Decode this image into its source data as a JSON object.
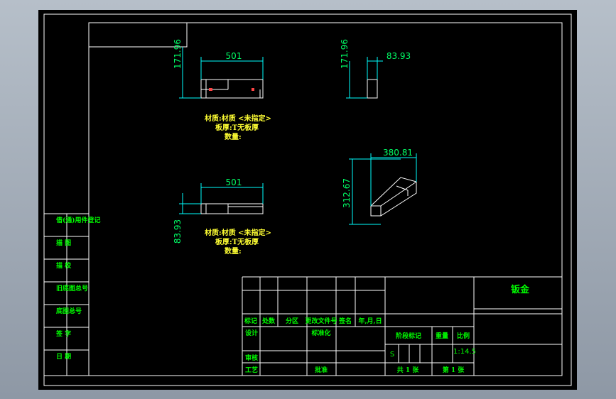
{
  "title_block": {
    "name": "钣金",
    "scale": "1:14.5",
    "stage_mark": "S",
    "headers": {
      "mark": "标记",
      "count": "处数",
      "zone": "分区",
      "doc_no": "更改文件号",
      "sign": "签名",
      "date": "年,月,日",
      "design": "设计",
      "standardize": "标准化",
      "review": "审核",
      "process": "工艺",
      "approve": "批准",
      "stage_label": "阶段标记",
      "weight": "重量",
      "scale_label": "比例",
      "sheets_total": "共 1 张",
      "sheet_no": "第 1 张"
    }
  },
  "side_panel": [
    "借(通)用件登记",
    "描 图",
    "描 校",
    "旧底图总号",
    "底图总号",
    "签 字",
    "日 期"
  ],
  "views": {
    "front": {
      "dim_width": "501",
      "dim_height": "171.96"
    },
    "side": {
      "dim_width": "83.93",
      "dim_height": "171.96"
    },
    "top": {
      "dim_width": "501",
      "dim_height": "83.93"
    },
    "iso": {
      "dim_width": "380.81",
      "dim_height": "312.67"
    }
  },
  "notes": {
    "line1": "材质:材质 <未指定>",
    "line2": "板厚:T无板厚",
    "line3": "数量:"
  }
}
